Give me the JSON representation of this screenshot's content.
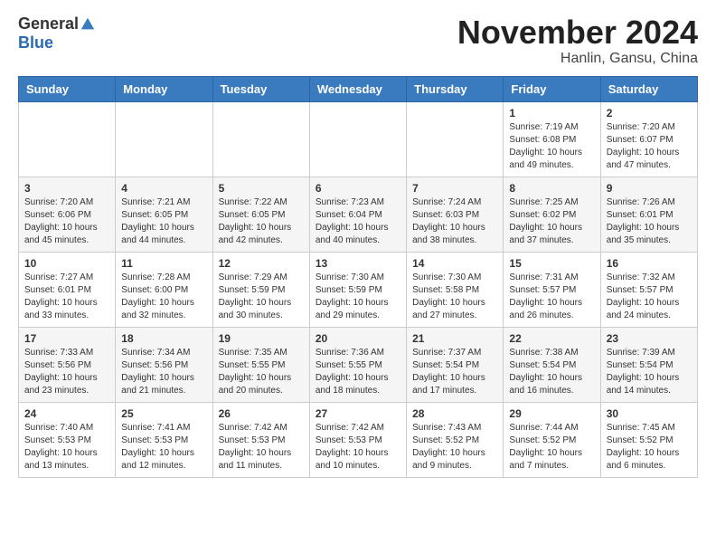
{
  "header": {
    "logo_general": "General",
    "logo_blue": "Blue",
    "month_title": "November 2024",
    "location": "Hanlin, Gansu, China"
  },
  "weekdays": [
    "Sunday",
    "Monday",
    "Tuesday",
    "Wednesday",
    "Thursday",
    "Friday",
    "Saturday"
  ],
  "weeks": [
    [
      {
        "day": "",
        "info": ""
      },
      {
        "day": "",
        "info": ""
      },
      {
        "day": "",
        "info": ""
      },
      {
        "day": "",
        "info": ""
      },
      {
        "day": "",
        "info": ""
      },
      {
        "day": "1",
        "info": "Sunrise: 7:19 AM\nSunset: 6:08 PM\nDaylight: 10 hours\nand 49 minutes."
      },
      {
        "day": "2",
        "info": "Sunrise: 7:20 AM\nSunset: 6:07 PM\nDaylight: 10 hours\nand 47 minutes."
      }
    ],
    [
      {
        "day": "3",
        "info": "Sunrise: 7:20 AM\nSunset: 6:06 PM\nDaylight: 10 hours\nand 45 minutes."
      },
      {
        "day": "4",
        "info": "Sunrise: 7:21 AM\nSunset: 6:05 PM\nDaylight: 10 hours\nand 44 minutes."
      },
      {
        "day": "5",
        "info": "Sunrise: 7:22 AM\nSunset: 6:05 PM\nDaylight: 10 hours\nand 42 minutes."
      },
      {
        "day": "6",
        "info": "Sunrise: 7:23 AM\nSunset: 6:04 PM\nDaylight: 10 hours\nand 40 minutes."
      },
      {
        "day": "7",
        "info": "Sunrise: 7:24 AM\nSunset: 6:03 PM\nDaylight: 10 hours\nand 38 minutes."
      },
      {
        "day": "8",
        "info": "Sunrise: 7:25 AM\nSunset: 6:02 PM\nDaylight: 10 hours\nand 37 minutes."
      },
      {
        "day": "9",
        "info": "Sunrise: 7:26 AM\nSunset: 6:01 PM\nDaylight: 10 hours\nand 35 minutes."
      }
    ],
    [
      {
        "day": "10",
        "info": "Sunrise: 7:27 AM\nSunset: 6:01 PM\nDaylight: 10 hours\nand 33 minutes."
      },
      {
        "day": "11",
        "info": "Sunrise: 7:28 AM\nSunset: 6:00 PM\nDaylight: 10 hours\nand 32 minutes."
      },
      {
        "day": "12",
        "info": "Sunrise: 7:29 AM\nSunset: 5:59 PM\nDaylight: 10 hours\nand 30 minutes."
      },
      {
        "day": "13",
        "info": "Sunrise: 7:30 AM\nSunset: 5:59 PM\nDaylight: 10 hours\nand 29 minutes."
      },
      {
        "day": "14",
        "info": "Sunrise: 7:30 AM\nSunset: 5:58 PM\nDaylight: 10 hours\nand 27 minutes."
      },
      {
        "day": "15",
        "info": "Sunrise: 7:31 AM\nSunset: 5:57 PM\nDaylight: 10 hours\nand 26 minutes."
      },
      {
        "day": "16",
        "info": "Sunrise: 7:32 AM\nSunset: 5:57 PM\nDaylight: 10 hours\nand 24 minutes."
      }
    ],
    [
      {
        "day": "17",
        "info": "Sunrise: 7:33 AM\nSunset: 5:56 PM\nDaylight: 10 hours\nand 23 minutes."
      },
      {
        "day": "18",
        "info": "Sunrise: 7:34 AM\nSunset: 5:56 PM\nDaylight: 10 hours\nand 21 minutes."
      },
      {
        "day": "19",
        "info": "Sunrise: 7:35 AM\nSunset: 5:55 PM\nDaylight: 10 hours\nand 20 minutes."
      },
      {
        "day": "20",
        "info": "Sunrise: 7:36 AM\nSunset: 5:55 PM\nDaylight: 10 hours\nand 18 minutes."
      },
      {
        "day": "21",
        "info": "Sunrise: 7:37 AM\nSunset: 5:54 PM\nDaylight: 10 hours\nand 17 minutes."
      },
      {
        "day": "22",
        "info": "Sunrise: 7:38 AM\nSunset: 5:54 PM\nDaylight: 10 hours\nand 16 minutes."
      },
      {
        "day": "23",
        "info": "Sunrise: 7:39 AM\nSunset: 5:54 PM\nDaylight: 10 hours\nand 14 minutes."
      }
    ],
    [
      {
        "day": "24",
        "info": "Sunrise: 7:40 AM\nSunset: 5:53 PM\nDaylight: 10 hours\nand 13 minutes."
      },
      {
        "day": "25",
        "info": "Sunrise: 7:41 AM\nSunset: 5:53 PM\nDaylight: 10 hours\nand 12 minutes."
      },
      {
        "day": "26",
        "info": "Sunrise: 7:42 AM\nSunset: 5:53 PM\nDaylight: 10 hours\nand 11 minutes."
      },
      {
        "day": "27",
        "info": "Sunrise: 7:42 AM\nSunset: 5:53 PM\nDaylight: 10 hours\nand 10 minutes."
      },
      {
        "day": "28",
        "info": "Sunrise: 7:43 AM\nSunset: 5:52 PM\nDaylight: 10 hours\nand 9 minutes."
      },
      {
        "day": "29",
        "info": "Sunrise: 7:44 AM\nSunset: 5:52 PM\nDaylight: 10 hours\nand 7 minutes."
      },
      {
        "day": "30",
        "info": "Sunrise: 7:45 AM\nSunset: 5:52 PM\nDaylight: 10 hours\nand 6 minutes."
      }
    ]
  ]
}
